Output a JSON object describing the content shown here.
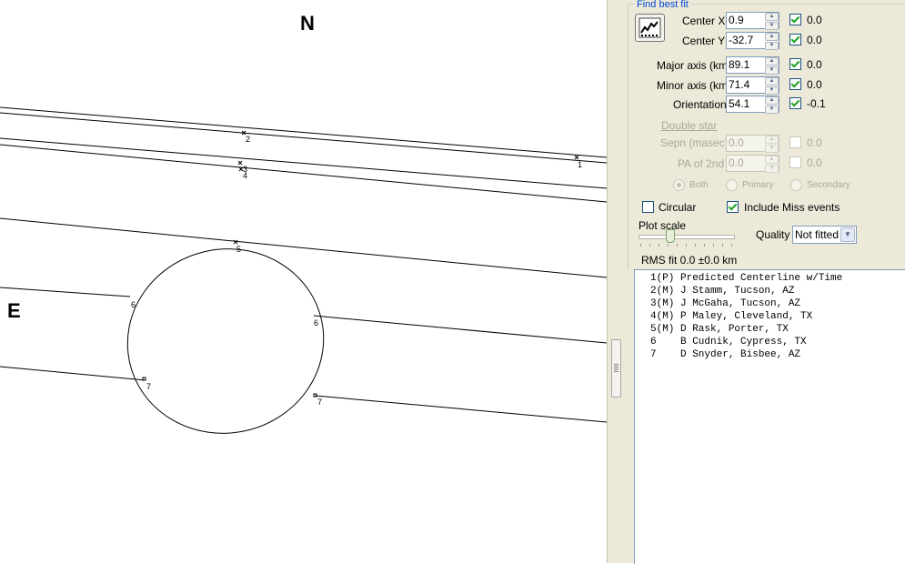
{
  "plot": {
    "north_label": "N",
    "east_label": "E",
    "chord_labels": [
      "1",
      "2",
      "3",
      "4",
      "5",
      "6",
      "6",
      "7",
      "7"
    ]
  },
  "panel": {
    "group_title": "Find best fit",
    "fit_button_icon": "fit-chart-icon",
    "parameters": [
      {
        "label": "Center X",
        "value": "0.9",
        "checked": true,
        "delta": "0.0"
      },
      {
        "label": "Center Y",
        "value": "-32.7",
        "checked": true,
        "delta": "0.0"
      },
      {
        "label": "Major axis (km)",
        "value": "89.1",
        "checked": true,
        "delta": "0.0"
      },
      {
        "label": "Minor axis (km)",
        "value": "71.4",
        "checked": true,
        "delta": "0.0"
      },
      {
        "label": "Orientation",
        "value": "54.1",
        "checked": true,
        "delta": "-0.1"
      }
    ],
    "double_star": {
      "title": "Double star",
      "sepn_label": "Sepn (masec)",
      "sepn_value": "0.0",
      "sepn_delta": "0.0",
      "pa_label": "PA of 2nd",
      "pa_value": "0.0",
      "pa_delta": "0.0",
      "radio_both": "Both",
      "radio_primary": "Primary",
      "radio_secondary": "Secondary"
    },
    "circular_label": "Circular",
    "circular_checked": false,
    "include_miss_label": "Include Miss events",
    "include_miss_checked": true,
    "plot_scale_label": "Plot scale",
    "quality_label": "Quality",
    "quality_value": "Not fitted",
    "rms_text": "RMS fit 0.0 ±0.0 km"
  },
  "observers": [
    "1(P) Predicted Centerline w/Time",
    "2(M) J Stamm, Tucson, AZ",
    "3(M) J McGaha, Tucson, AZ",
    "4(M) P Maley, Cleveland, TX",
    "5(M) D Rask, Porter, TX",
    "6    B Cudnik, Cypress, TX",
    "7    D Snyder, Bisbee, AZ"
  ]
}
